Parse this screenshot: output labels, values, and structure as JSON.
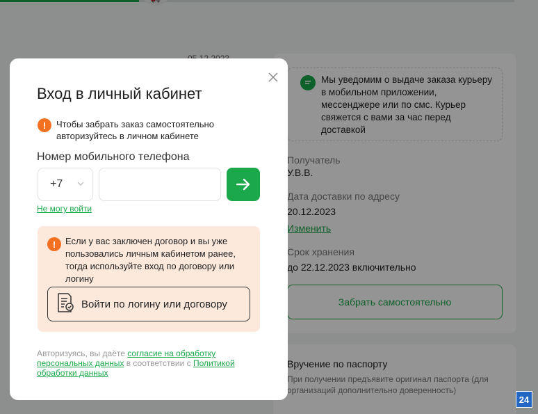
{
  "background": {
    "progress": 0.27,
    "date": "05.12.2023",
    "notice": "Мы уведомим о выдаче заказа курьеру в мобильном приложении, мессенджере или по смс. Курьер свяжется с вами за час перед доставкой",
    "recipient_label": "Получатель",
    "recipient_value": "У.В.В.",
    "delivery_label": "Дата доставки по адресу",
    "delivery_value": "20.12.2023",
    "change_link": "Изменить",
    "storage_label": "Срок хранения",
    "storage_value": "до 22.12.2023 включительно",
    "pickup_button": "Забрать самостоятельно",
    "passport_title": "Вручение по паспорту",
    "passport_text": "При получении предъявите оригинал паспорта (для организаций дополнительно доверенность)"
  },
  "modal": {
    "title": "Вход в личный кабинет",
    "hint": "Чтобы забрать заказ самостоятельно авторизуйтесь в личном кабинете",
    "phone_label": "Номер мобильного телефона",
    "country_code": "+7",
    "phone_value": "",
    "cant_login": "Не могу войти",
    "contract_hint": "Если у вас заключен договор и вы уже пользовались личным кабинетом ранее, тогда используйте вход по договору или логину",
    "contract_button": "Войти по логину или договору",
    "consent_prefix": "Авторизуясь, вы даёте ",
    "consent_link": "согласие на обработку персональных данных",
    "consent_middle": " в соответствии с ",
    "policy_link": "Политикой обработки данных"
  },
  "badge": "24",
  "colors": {
    "accent": "#1aa84a",
    "warning": "#f37021",
    "contract_bg": "#fde9dc"
  }
}
